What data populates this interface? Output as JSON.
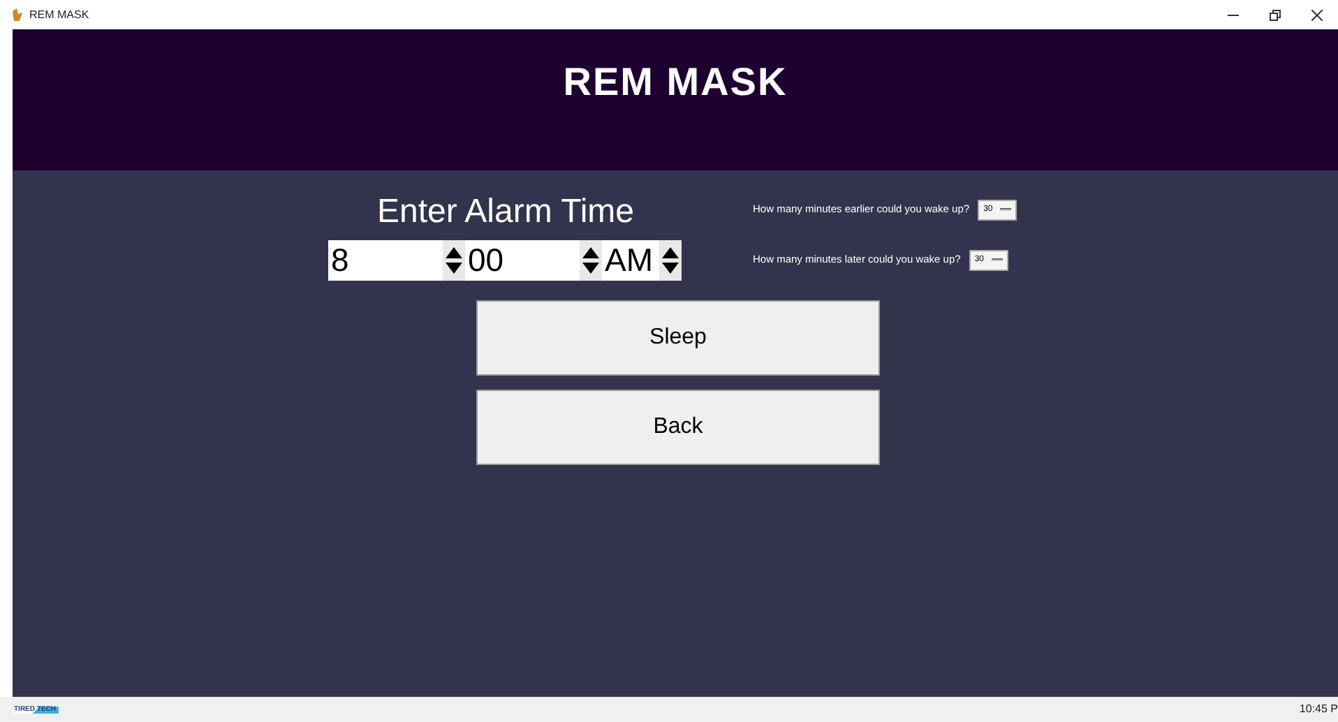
{
  "window": {
    "title": "REM MASK"
  },
  "header": {
    "title": "REM MASK"
  },
  "alarm": {
    "heading": "Enter Alarm Time",
    "spinboxes": [
      {
        "value": "8"
      },
      {
        "value": "00"
      },
      {
        "value": "AM"
      }
    ]
  },
  "options": [
    {
      "label": "How many minutes earlier could you wake up?",
      "value": "30"
    },
    {
      "label": "How many minutes later could you wake up?",
      "value": "30"
    }
  ],
  "buttons": [
    "Sleep",
    "Back"
  ],
  "taskbar": {
    "logo": "TIRED TECH",
    "clock": "10:45 P"
  }
}
